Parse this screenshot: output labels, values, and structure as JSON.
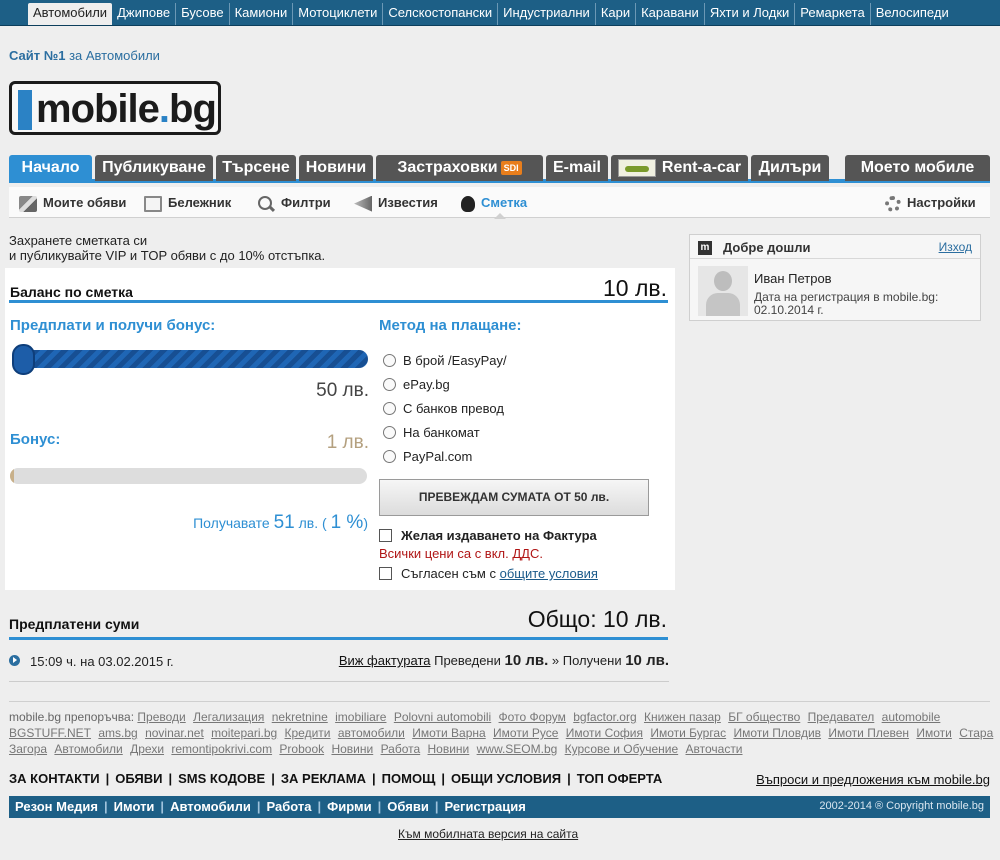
{
  "top_categories": [
    {
      "label": "Автомобили",
      "active": true
    },
    {
      "label": "Джипове"
    },
    {
      "label": "Бусове"
    },
    {
      "label": "Камиони"
    },
    {
      "label": "Мотоциклети"
    },
    {
      "label": "Селскостопански"
    },
    {
      "label": "Индустриални"
    },
    {
      "label": "Кари"
    },
    {
      "label": "Каравани"
    },
    {
      "label": "Яхти и Лодки"
    },
    {
      "label": "Ремаркета"
    },
    {
      "label": "Велосипеди"
    }
  ],
  "site_tag": {
    "bold": "Сайт №1",
    "rest": " за Автомобили"
  },
  "logo": {
    "text_main": "mobile",
    "text_dot": ".",
    "text_tld": "bg"
  },
  "main_nav": {
    "home": "Начало",
    "publish": "Публикуване",
    "search": "Търсене",
    "news": "Новини",
    "insurance": "Застраховки",
    "insurance_badge": "SDI",
    "email": "E-mail",
    "rentacar": "Rent-a-car",
    "dealers": "Дилъри",
    "my_mobile": "Моето мобиле"
  },
  "sub_nav": {
    "my_ads": "Моите обяви",
    "notebook": "Бележник",
    "filters": "Филтри",
    "notifications": "Известия",
    "account": "Сметка",
    "settings": "Настройки"
  },
  "intro": {
    "line1": "Захранете сметката си",
    "line2": "и публикувайте VIP и TOP обяви с до 10% отстъпка."
  },
  "balance": {
    "title": "Баланс по сметка",
    "amount": "10 лв."
  },
  "prepay": {
    "heading": "Предплати и получи бонус:",
    "value": "50 лв.",
    "bonus_heading": "Бонус:",
    "bonus_value": "1 лв.",
    "bonus_fill": 0.01,
    "receive_prefix": "Получавате",
    "receive_amount": "51",
    "receive_mid": "лв. (",
    "receive_pct": "1 %",
    "receive_suffix": ")"
  },
  "payment": {
    "heading": "Метод на плащане:",
    "methods": [
      "В брой /EasyPay/",
      "ePay.bg",
      "С банков превод",
      "На банкомат",
      "PayPal.com"
    ],
    "button": "ПРЕВЕЖДАМ СУМАТА ОТ 50 лв.",
    "invoice_label": "Желая издаването на Фактура",
    "vat_note": "Всички цени са с вкл. ДДС.",
    "terms_prefix": "Съгласен съм с ",
    "terms_link": "общите условия"
  },
  "welcome": {
    "icon_letter": "m",
    "title": "Добре дошли",
    "exit": "Изход",
    "name": "Иван Петров",
    "reg_label": "Дата на регистрация в mobile.bg:",
    "reg_date": "02.10.2014 г."
  },
  "prepaid": {
    "title": "Предплатени суми",
    "total": "Общо: 10 лв.",
    "rows": [
      {
        "time": "15:09 ч. на 03.02.2015 г.",
        "invoice_link": "Виж фактурата",
        "transferred_label": "Преведени",
        "transferred": "10 лв.",
        "sep": "»",
        "received_label": "Получени",
        "received": "10 лв."
      }
    ]
  },
  "footer": {
    "recommends_label": "mobile.bg препоръчва:",
    "recommends": [
      "Преводи",
      "Легализация",
      "nekretnine",
      "imobiliare",
      "Polovni automobili",
      "Фото Форум",
      "bgfactor.org",
      "Книжен пазар",
      "БГ общество",
      "Предавател",
      "automobile",
      "BGSTUFF.NET",
      "ams.bg",
      "novinar.net",
      "moitepari.bg",
      "Кредити",
      "автомобили",
      "Имоти Варна",
      "Имоти Русе",
      "Имоти София",
      "Имоти Бургас",
      "Имоти Пловдив",
      "Имоти Плевен",
      "Имоти",
      "Стара Загора",
      "Автомобили",
      "Дрехи",
      "remontipokrivi.com",
      "Probook",
      "Новини",
      "Работа",
      "Новини",
      "www.SEOM.bg",
      "Курсове и Обучение",
      "Авточасти"
    ],
    "main_links": [
      "ЗА КОНТАКТИ",
      "ОБЯВИ",
      "SMS КОДОВЕ",
      "ЗА РЕКЛАМА",
      "ПОМОЩ",
      "ОБЩИ УСЛОВИЯ",
      "ТОП ОФЕРТА"
    ],
    "feedback": "Въпроси и предложения към mobile.bg",
    "bottom_links": [
      "Резон Медия",
      "Имоти",
      "Автомобили",
      "Работа",
      "Фирми",
      "Обяви",
      "Регистрация"
    ],
    "copyright": "2002-2014 ® Copyright mobile.bg",
    "mobile_version": "Към мобилната версия на сайта"
  },
  "colors": {
    "accent": "#2e8fd3",
    "top_bar": "#1d5f86",
    "bonus": "#b4a07f",
    "vat": "#b01515"
  }
}
